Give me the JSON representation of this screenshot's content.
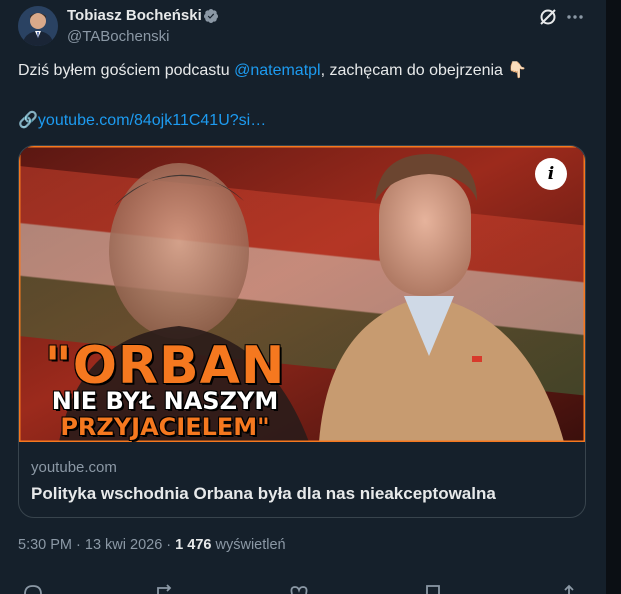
{
  "author": {
    "name": "Tobiasz Bocheński",
    "handle": "@TABochenski"
  },
  "post": {
    "text_before": "Dziś byłem gościem podcastu ",
    "mention": "@natematpl",
    "text_after": ", zachęcam do obejrzenia 👇🏻",
    "link_icon": "🔗",
    "url": "youtube.com/84ojk11C41U?si…"
  },
  "card": {
    "overlay_line1": "\"ORBAN",
    "overlay_line2": "NIE BYŁ NASZYM",
    "overlay_line3": "PRZYJACIELEM\"",
    "info_icon": "i",
    "domain": "youtube.com",
    "title": "Polityka wschodnia Orbana była dla nas nieakceptowalna"
  },
  "meta": {
    "time": "5:30 PM",
    "separator": " · ",
    "date": "13 kwi 2026",
    "views_count": "1 476",
    "views_label": " wyświetleń"
  },
  "icons": {
    "verified": "verified-badge-icon",
    "grok": "grok-icon",
    "more": "more-options-icon",
    "info": "info-icon"
  },
  "colors": {
    "background": "#15202b",
    "accent": "#1d9bf0",
    "overlay_orange": "#f5781f"
  }
}
